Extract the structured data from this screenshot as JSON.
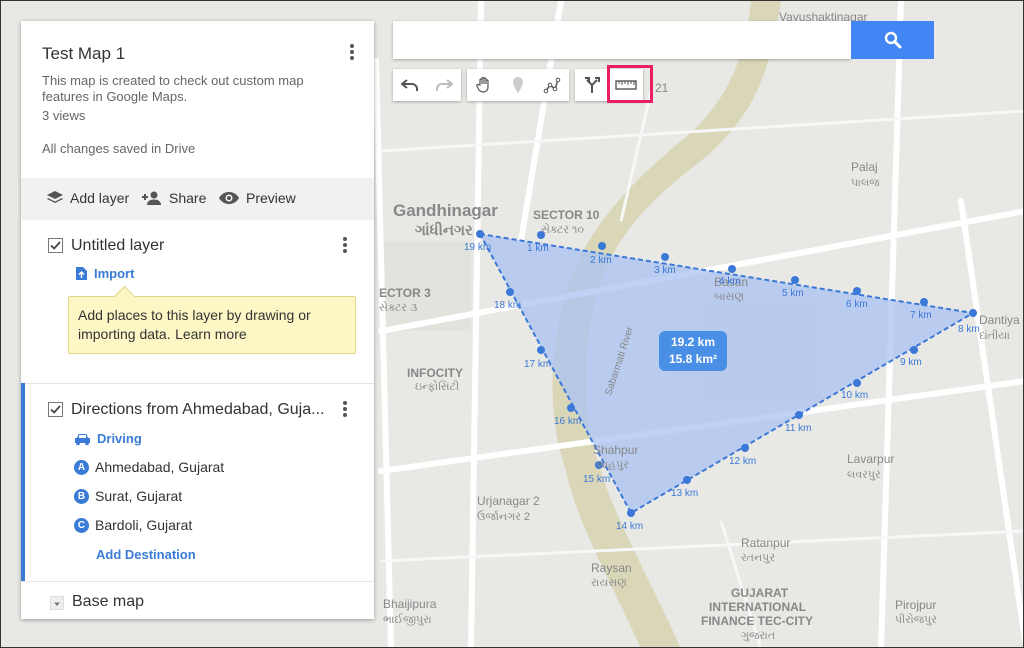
{
  "panel": {
    "title": "Test Map 1",
    "description": "This map is created to check out custom map features in Google Maps.",
    "views": "3 views",
    "saved_status": "All changes saved in Drive",
    "actions": {
      "add_layer": "Add layer",
      "share": "Share",
      "preview": "Preview"
    },
    "layers": [
      {
        "name": "Untitled layer",
        "import_label": "Import",
        "tip_text": "Add places to this layer by drawing or importing data.",
        "tip_link": "Learn more"
      },
      {
        "name": "Directions from Ahmedabad, Guja...",
        "mode": "Driving",
        "waypoints": [
          {
            "letter": "A",
            "label": "Ahmedabad, Gujarat"
          },
          {
            "letter": "B",
            "label": "Surat, Gujarat"
          },
          {
            "letter": "C",
            "label": "Bardoli, Gujarat"
          }
        ],
        "add_destination": "Add Destination"
      }
    ],
    "base_map": "Base map"
  },
  "search": {
    "placeholder": ""
  },
  "measurement": {
    "distance": "19.2 km",
    "area": "15.8 km²"
  },
  "km_labels": [
    "1 km",
    "2 km",
    "3 km",
    "4 km",
    "5 km",
    "6 km",
    "7 km",
    "8 km",
    "9 km",
    "10 km",
    "11 km",
    "12 km",
    "13 km",
    "14 km",
    "15 km",
    "16 km",
    "17 km",
    "18 km",
    "19 km"
  ],
  "map_labels": {
    "gandhinagar": "Gandhinagar",
    "gandhinagar_gu": "ગાંધીનગર",
    "sector10": "SECTOR 10",
    "sector10_gu": "સેક્ટર ૧૦",
    "sector3": "ECTOR 3",
    "sector3_gu": "સેક્ટર ૩",
    "infocity": "INFOCITY",
    "infocity_gu": "ઇન્ફોસિટી",
    "basan": "Basan",
    "basan_gu": "બાસણ",
    "shahpur": "Shahpur",
    "shahpur_gu": "શાહપુર",
    "urjanagar": "Urjanagar 2",
    "urjanagar_gu": "ઉર્જાનગર 2",
    "raysan": "Raysan",
    "raysan_gu": "રાયસણ",
    "bhaijipura": "Bhaijipura",
    "bhaijipura_gu": "ભાઈજીપુરા",
    "gift1": "GUJARAT",
    "gift2": "INTERNATIONAL",
    "gift3": "FINANCE TEC-CITY",
    "gift_gu": "ગુજરાત",
    "ratanpur": "Ratanpur",
    "ratanpur_gu": "રતનપુર",
    "pirojpur": "Pirojpur",
    "pirojpur_gu": "પીરોજપુર",
    "lavarpur": "Lavarpur",
    "lavarpur_gu": "લવરપુર",
    "palaj": "Palaj",
    "palaj_gu": "પાલજ",
    "vayushakti": "Vayushaktinagar",
    "dantiya": "Dantiya",
    "dantiya_gu": "દાંતીયા",
    "sabarmati": "Sabarmati River",
    "n21": "21"
  },
  "colors": {
    "accent": "#3a7bd5",
    "measure_fill": "#a9c3f2",
    "highlight": "#e91e63"
  }
}
